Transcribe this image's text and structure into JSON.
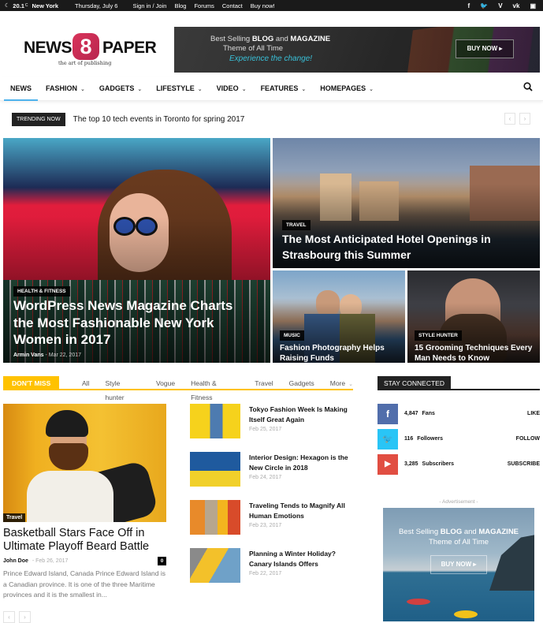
{
  "topbar": {
    "weather_icon": "moon-icon",
    "temperature": "20.1",
    "unit": "C",
    "city": "New York",
    "date": "Thursday, July 6",
    "links": [
      "Sign in / Join",
      "Blog",
      "Forums",
      "Contact",
      "Buy now!"
    ],
    "social": [
      {
        "name": "facebook-icon",
        "glyph": "f"
      },
      {
        "name": "twitter-icon",
        "glyph": "🐦"
      },
      {
        "name": "vimeo-icon",
        "glyph": "V"
      },
      {
        "name": "vk-icon",
        "glyph": "vk"
      },
      {
        "name": "youtube-icon",
        "glyph": "▣"
      }
    ]
  },
  "logo": {
    "left": "NEWS",
    "number": "8",
    "right": "PAPER",
    "tagline": "the art of publishing"
  },
  "header_ad": {
    "line1_prefix": "Best Selling ",
    "line1_bold1": "BLOG",
    "line1_mid": " and ",
    "line1_bold2": "MAGAZINE",
    "line2": "Theme of All Time",
    "line3": "Experience the change!",
    "button": "BUY NOW ▸"
  },
  "nav": {
    "items": [
      {
        "label": "NEWS",
        "dropdown": false,
        "active": true
      },
      {
        "label": "FASHION",
        "dropdown": true
      },
      {
        "label": "GADGETS",
        "dropdown": true
      },
      {
        "label": "LIFESTYLE",
        "dropdown": true
      },
      {
        "label": "VIDEO",
        "dropdown": true
      },
      {
        "label": "FEATURES",
        "dropdown": true
      },
      {
        "label": "HOMEPAGES",
        "dropdown": true
      }
    ],
    "chevron": "⌄",
    "search_icon": "⚲"
  },
  "trending": {
    "label": "TRENDING NOW",
    "text": "The top 10 tech events in Toronto for spring 2017",
    "prev": "‹",
    "next": "›"
  },
  "featured": [
    {
      "category": "HEALTH & FITNESS",
      "title": "WordPress News Magazine Charts the Most Fashionable New York Women in 2017",
      "author": "Armin Vans",
      "date": "Mar 22, 2017"
    },
    {
      "category": "TRAVEL",
      "title": "The Most Anticipated Hotel Openings in Strasbourg this Summer"
    },
    {
      "category": "MUSIC",
      "title": "Fashion Photography Helps Raising Funds"
    },
    {
      "category": "STYLE HUNTER",
      "title": "15 Grooming Techniques Every Man Needs to Know"
    }
  ],
  "dont_miss": {
    "label": "DON'T MISS",
    "tabs": [
      "All",
      "Style hunter",
      "Vogue",
      "Health & Fitness",
      "Travel",
      "Gadgets",
      "More"
    ],
    "more_chevron": "⌄",
    "main": {
      "category": "Travel",
      "title": "Basketball Stars Face Off in Ultimate Playoff Beard Battle",
      "author": "John Doe",
      "date": "Feb 26, 2017",
      "comments": "0",
      "excerpt": "Prince Edward Island, Canada Prince Edward Island is a Canadian province. It is one of the three Maritime provinces and it is the smallest in..."
    },
    "list": [
      {
        "title": "Tokyo Fashion Week Is Making Itself Great Again",
        "date": "Feb 25, 2017"
      },
      {
        "title": "Interior Design: Hexagon is the New Circle in 2018",
        "date": "Feb 24, 2017"
      },
      {
        "title": "Traveling Tends to Magnify All Human Emotions",
        "date": "Feb 23, 2017"
      },
      {
        "title": "Planning a Winter Holiday? Canary Islands Offers",
        "date": "Feb 22, 2017"
      }
    ],
    "prev": "‹",
    "next": "›"
  },
  "stay_connected": {
    "label": "STAY CONNECTED",
    "rows": [
      {
        "icon": "f",
        "count": "4,847",
        "unit": "Fans",
        "action": "LIKE",
        "color": "#516eab"
      },
      {
        "icon": "🐦",
        "count": "116",
        "unit": "Followers",
        "action": "FOLLOW",
        "color": "#29c5f6"
      },
      {
        "icon": "▶",
        "count": "3,285",
        "unit": "Subscribers",
        "action": "SUBSCRIBE",
        "color": "#e14e42"
      }
    ]
  },
  "sidebar_ad": {
    "label": "- Advertisement -",
    "line1_prefix": "Best Selling ",
    "line1_bold1": "BLOG",
    "line1_mid": " and ",
    "line1_bold2": "MAGAZINE",
    "line2": "Theme of All Time",
    "button": "BUY NOW ▸"
  },
  "colors": {
    "accent_blue": "#4db2ec",
    "dont_miss_yellow": "#ffc200",
    "dark": "#222222"
  }
}
